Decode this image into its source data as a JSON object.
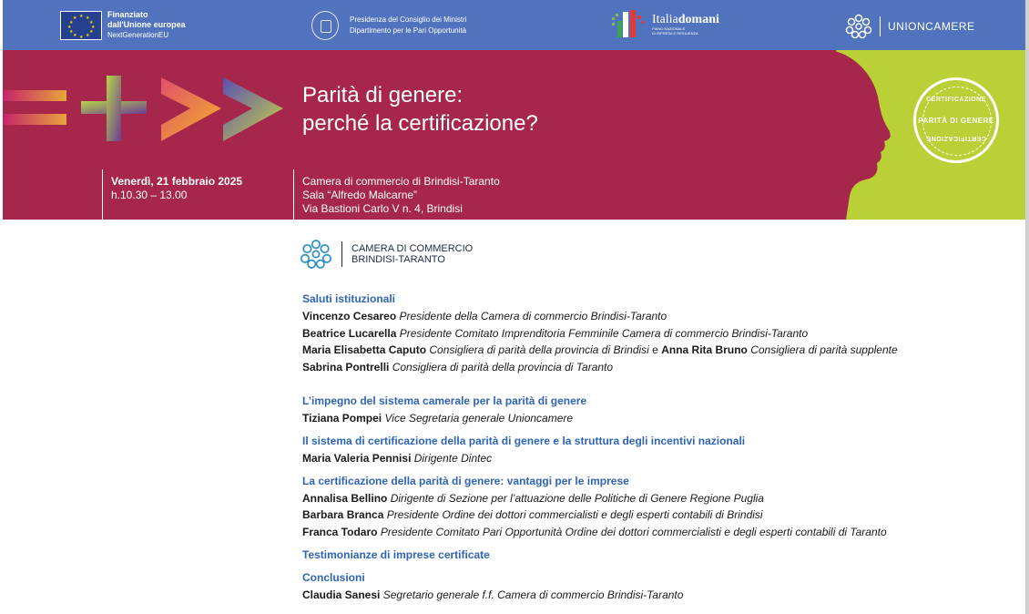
{
  "colors": {
    "logobar": "#5173bd",
    "band": "#a6264c",
    "lime": "#b9d037",
    "section_title": "#2e64b7"
  },
  "logos": {
    "eu": {
      "line1": "Finanziato",
      "line2": "dall'Unione europea",
      "line3": "NextGenerationEU"
    },
    "pcm": {
      "line1": "Presidenza del Consiglio dei Ministri",
      "line2": "Dipartimento per le Pari Opportunità"
    },
    "italia": {
      "a": "Italia",
      "b": "domani",
      "sub1": "PIANO NAZIONALE",
      "sub2": "DI RIPRESA E RESILIENZA"
    },
    "unioncamere": {
      "label": "UNIONCAMERE"
    }
  },
  "header": {
    "title_line1": "Parità di genere:",
    "title_line2": "perché la certificazione?",
    "date": "Venerdì, 21 febbraio 2025",
    "time": "h.10.30 – 13.00",
    "venue_line1": "Camera di commercio di Brindisi-Taranto",
    "venue_line2": "Sala “Alfredo Malcarne”",
    "venue_line3": "Via Bastioni Carlo V n. 4, Brindisi",
    "seal_top": "CERTIFICAZIONE",
    "seal_mid": "PARITÀ DI GENERE",
    "seal_bottom": "CERTIFICAZIONE"
  },
  "ccia": {
    "line1": "CAMERA DI COMMERCIO",
    "line2": "BRINDISI-TARANTO"
  },
  "program": {
    "s1": {
      "title": "Saluti istituzionali",
      "p1_name": "Vincenzo Cesareo",
      "p1_role": "Presidente della Camera di commercio Brindisi-Taranto",
      "p2_name": "Beatrice Lucarella",
      "p2_role": "Presidente Comitato Imprenditoria Femminile Camera di commercio Brindisi-Taranto",
      "p3_name": "Maria Elisabetta Caputo",
      "p3_role": "Consigliera di parità della provincia di Brindisi",
      "p3_and": "e",
      "p3b_name": "Anna Rita Bruno",
      "p3b_role": "Consigliera di parità supplente",
      "p4_name": "Sabrina Pontrelli",
      "p4_role": "Consigliera di parità della provincia di Taranto"
    },
    "s2": {
      "title": "L’impegno del sistema camerale per la parità di genere",
      "p1_name": "Tiziana Pompei",
      "p1_role": "Vice Segretaria generale Unioncamere"
    },
    "s3": {
      "title": "Il sistema di certificazione della parità di genere e la struttura degli incentivi nazionali",
      "p1_name": "Maria Valeria Pennisi",
      "p1_role": "Dirigente Dintec"
    },
    "s4": {
      "title": "La certificazione della parità di genere: vantaggi per le imprese",
      "p1_name": "Annalisa Bellino",
      "p1_role": "Dirigente di Sezione per l’attuazione delle Politiche di Genere Regione Puglia",
      "p2_name": "Barbara Branca",
      "p2_role": "Presidente Ordine dei dottori commercialisti e degli esperti contabili di Brindisi",
      "p3_name": "Franca Todaro",
      "p3_role": "Presidente Comitato Pari Opportunità Ordine dei dottori commercialisti e degli esperti contabili di Taranto"
    },
    "s5": {
      "title": "Testimonianze di imprese certificate"
    },
    "s6": {
      "title": "Conclusioni",
      "p1_name": "Claudia Sanesi",
      "p1_role": "Segretario generale f.f. Camera di commercio Brindisi-Taranto"
    }
  }
}
